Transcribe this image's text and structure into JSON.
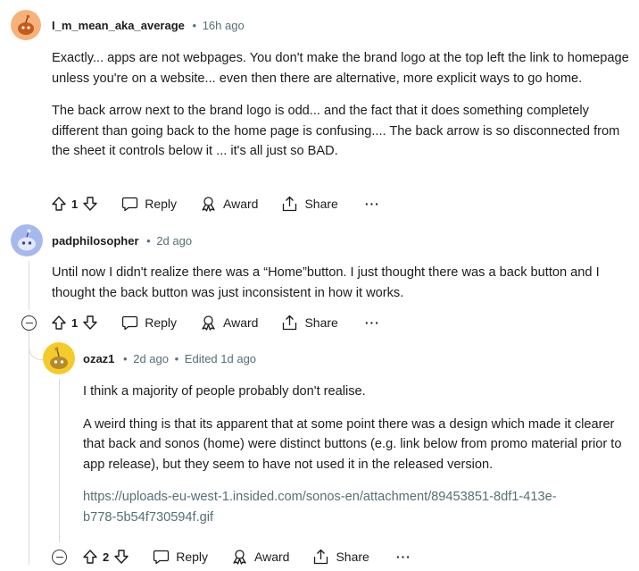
{
  "comments": [
    {
      "user": "I_m_mean_aka_average",
      "time": "16h ago",
      "paragraphs": [
        "Exactly... apps are not webpages. You don't make the brand logo at the top left the link to homepage unless you're on a website... even then there are alternative, more explicit ways to go home.",
        "The back arrow next to the brand logo is odd... and the fact that it does something completely different than going back to the home page is confusing.... The back arrow is so disconnected from the sheet it controls below it ... it's all just so BAD."
      ],
      "votes": "1",
      "avatar_color": "#f4a261"
    },
    {
      "user": "padphilosopher",
      "time": "2d ago",
      "paragraphs": [
        "Until now I didn't realize there was a “Home”button. I just thought there was a back button and I thought the back button was just inconsistent in how it works."
      ],
      "votes": "1",
      "avatar_color": "#8fa6e0"
    },
    {
      "user": "ozaz1",
      "time": "2d ago",
      "edited": "Edited 1d ago",
      "paragraphs": [
        "I think a majority of people probably don't realise.",
        "A weird thing is that its apparent that at some point there was a design which made it clearer that back and sonos (home) were distinct buttons (e.g. link below from promo material prior to app release), but they seem to have not used it in the released version."
      ],
      "link_line1": "https://uploads-eu-west-1.insided.com/sonos-en/attachment/89453851-8df1-413e-",
      "link_line2": "b778-5b54f730594f.gif",
      "votes": "2",
      "avatar_color": "#f2c21b"
    }
  ],
  "actions": {
    "reply": "Reply",
    "award": "Award",
    "share": "Share",
    "more": "···",
    "separator": "•"
  },
  "icons": [
    "upvote-icon",
    "downvote-icon",
    "comment-icon",
    "award-icon",
    "share-icon",
    "collapse-icon",
    "snoo-avatar-icon"
  ]
}
